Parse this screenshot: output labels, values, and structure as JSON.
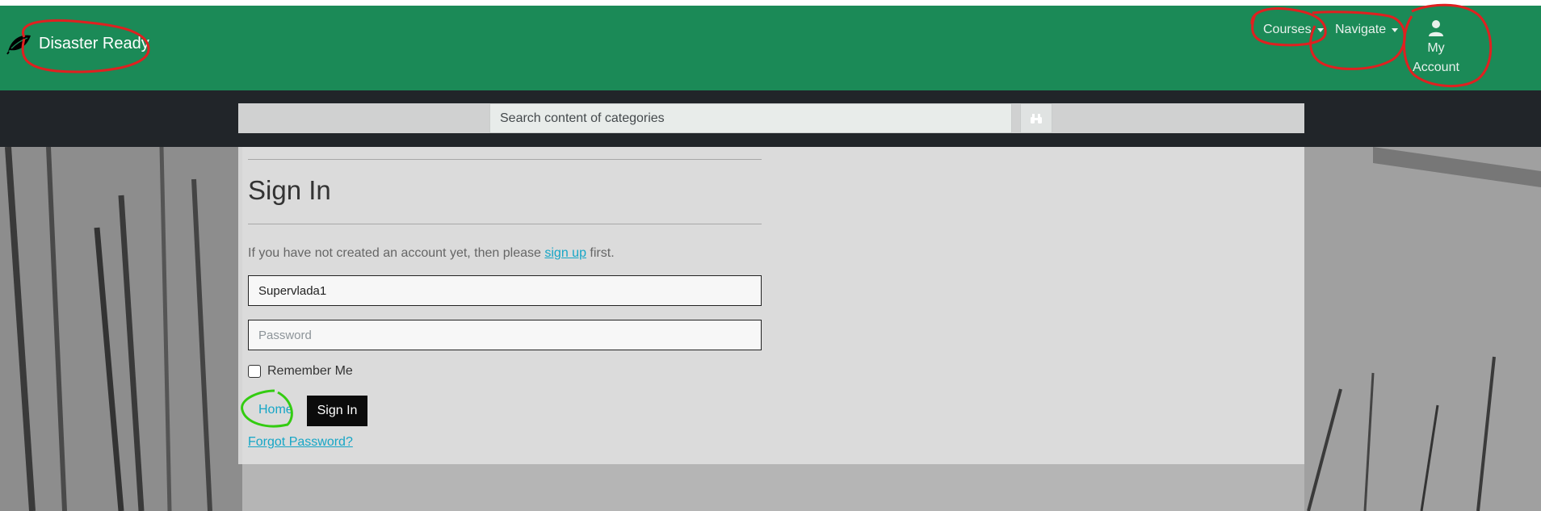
{
  "brand": {
    "title": "Disaster Ready",
    "icon": "leaf-icon"
  },
  "nav": {
    "courses": "Courses",
    "navigate": "Navigate",
    "account_line1": "My",
    "account_line2": "Account",
    "account_icon": "user-icon"
  },
  "search": {
    "placeholder": "Search content of categories",
    "button_icon": "binoculars-icon"
  },
  "form": {
    "title": "Sign In",
    "info_before": "If you have not created an account yet, then please",
    "signup_link": "sign up",
    "info_after": "first.",
    "username_value": "Supervlada1",
    "password_placeholder": "Password",
    "remember_label": "Remember Me",
    "remember_checked": false,
    "home_link": "Home",
    "signin_button": "Sign In",
    "forgot_link": "Forgot Password?"
  },
  "colors": {
    "navbar": "#1b8a57",
    "searchbar": "#212529",
    "link": "#16a6c6",
    "button": "#0b0b0b",
    "annotation_red": "#e02020",
    "annotation_green": "#33cc11"
  }
}
